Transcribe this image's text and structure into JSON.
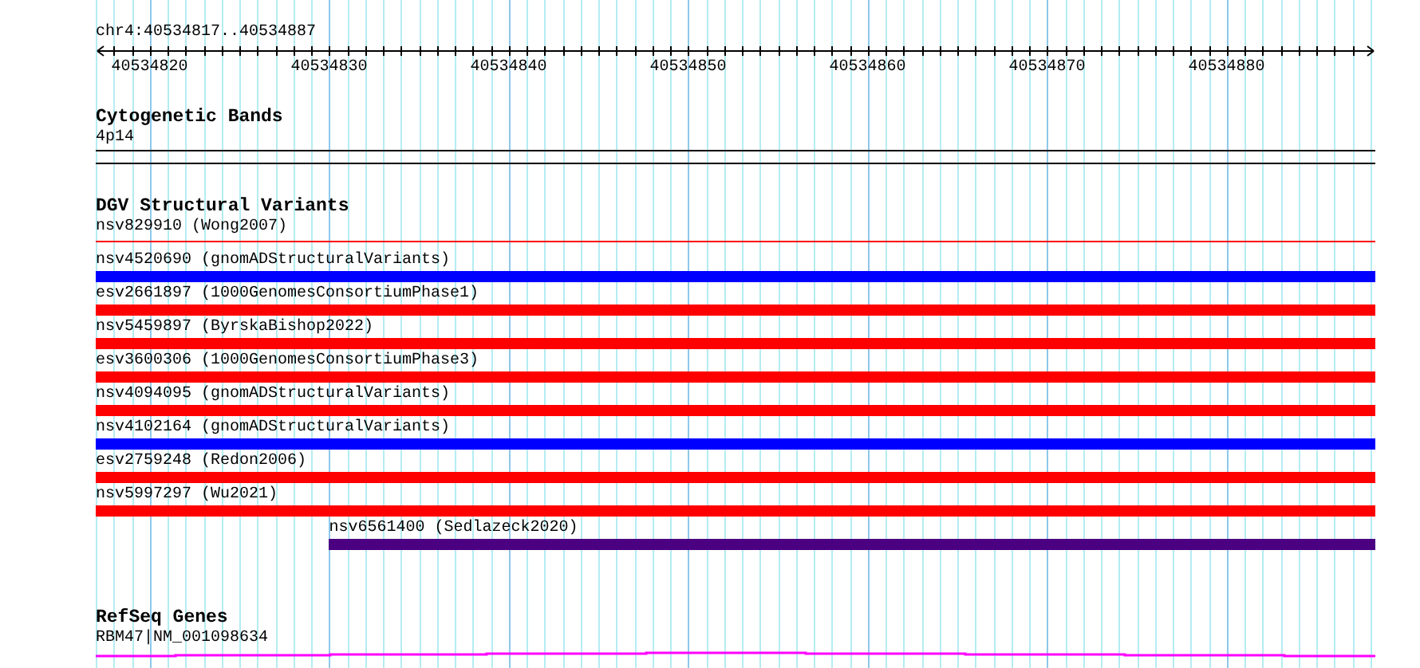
{
  "location": "chr4:40534817..40534887",
  "axis": {
    "tick_labels": [
      "40534820",
      "40534830",
      "40534840",
      "40534850",
      "40534860",
      "40534870",
      "40534880"
    ]
  },
  "tracks": [
    {
      "title": "Cytogenetic Bands",
      "kind": "bands",
      "features": [
        {
          "label": "4p14",
          "kind": "band"
        }
      ]
    },
    {
      "title": "DGV Structural Variants",
      "kind": "variants",
      "features": [
        {
          "label": "nsv829910 (Wong2007)",
          "kind": "line",
          "color": "#ff0000"
        },
        {
          "label": "nsv4520690 (gnomADStructuralVariants)",
          "kind": "bar",
          "color": "#0000ff"
        },
        {
          "label": "esv2661897 (1000GenomesConsortiumPhase1)",
          "kind": "bar",
          "color": "#ff0000"
        },
        {
          "label": "nsv5459897 (ByrskaBishop2022)",
          "kind": "bar",
          "color": "#ff0000"
        },
        {
          "label": "esv3600306 (1000GenomesConsortiumPhase3)",
          "kind": "bar",
          "color": "#ff0000"
        },
        {
          "label": "nsv4094095 (gnomADStructuralVariants)",
          "kind": "bar",
          "color": "#ff0000"
        },
        {
          "label": "nsv4102164 (gnomADStructuralVariants)",
          "kind": "bar",
          "color": "#0000ff"
        },
        {
          "label": "esv2759248 (Redon2006)",
          "kind": "bar",
          "color": "#ff0000"
        },
        {
          "label": "nsv5997297 (Wu2021)",
          "kind": "bar",
          "color": "#ff0000"
        },
        {
          "label": "nsv6561400 (Sedlazeck2020)",
          "kind": "late-bar",
          "color": "#4b0082"
        }
      ]
    },
    {
      "title": "RefSeq Genes",
      "kind": "genes",
      "features": [
        {
          "label": "RBM47|NM_001098634",
          "kind": "gene"
        }
      ]
    }
  ]
}
